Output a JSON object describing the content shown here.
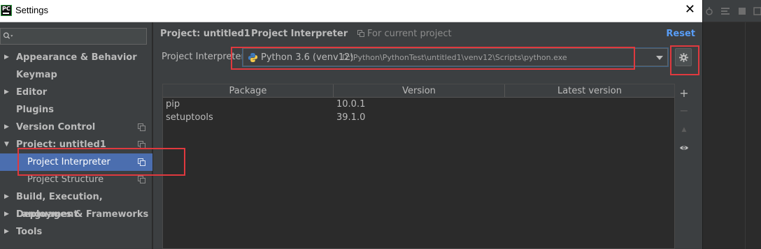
{
  "window": {
    "logo_text": "PC",
    "title": "Settings",
    "close_glyph": "✕"
  },
  "sidebar": {
    "search_placeholder": "",
    "items": [
      {
        "label": "Appearance & Behavior",
        "arrow": "▶",
        "level": 0
      },
      {
        "label": "Keymap",
        "arrow": "",
        "level": 0
      },
      {
        "label": "Editor",
        "arrow": "▶",
        "level": 0
      },
      {
        "label": "Plugins",
        "arrow": "",
        "level": 0
      },
      {
        "label": "Version Control",
        "arrow": "▶",
        "level": 0,
        "copy_icon": true
      },
      {
        "label": "Project: untitled1",
        "arrow": "▼",
        "level": 0,
        "copy_icon": true
      },
      {
        "label": "Project Interpreter",
        "arrow": "",
        "level": 1,
        "copy_icon": true,
        "selected": true
      },
      {
        "label": "Project Structure",
        "arrow": "",
        "level": 1,
        "copy_icon": true
      },
      {
        "label": "Build, Execution, Deployment",
        "arrow": "▶",
        "level": 0
      },
      {
        "label": "Languages & Frameworks",
        "arrow": "▶",
        "level": 0
      },
      {
        "label": "Tools",
        "arrow": "▶",
        "level": 0
      }
    ]
  },
  "breadcrumb": {
    "project": "Project: untitled1",
    "separator": "›",
    "page": "Project Interpreter",
    "scope": "For current project",
    "reset": "Reset"
  },
  "interpreter": {
    "label": "Project Interpreter:",
    "name": "Python 3.6 (venv12)",
    "path": "D:\\Python\\PythonTest\\untitled1\\venv12\\Scripts\\python.exe"
  },
  "packages": {
    "columns": [
      "Package",
      "Version",
      "Latest version"
    ],
    "rows": [
      {
        "package": "pip",
        "version": "10.0.1",
        "latest": ""
      },
      {
        "package": "setuptools",
        "version": "39.1.0",
        "latest": ""
      }
    ]
  },
  "table_tools": {
    "add": "+",
    "remove": "−",
    "upgrade": "▲",
    "show": "eye-icon"
  },
  "colors": {
    "selection": "#4b6eaf",
    "highlight": "#e0393e",
    "link": "#589df6",
    "panel": "#3c3f41",
    "table_bg": "#2b2b2b"
  }
}
